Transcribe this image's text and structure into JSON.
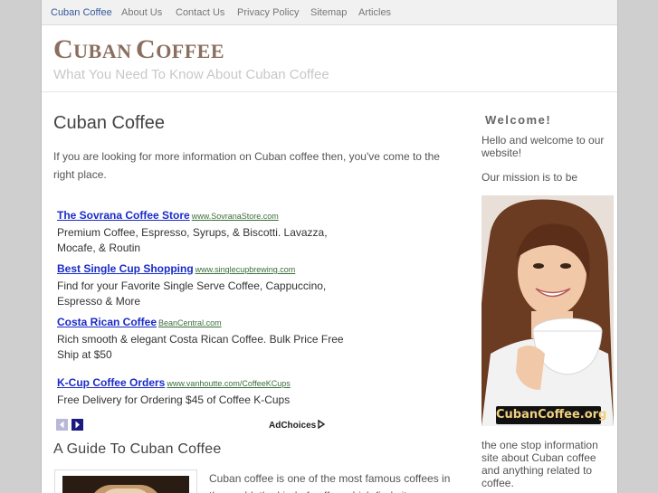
{
  "nav": {
    "items": [
      {
        "label": "Cuban Coffee",
        "active": true
      },
      {
        "label": "About Us"
      },
      {
        "label": "Contact Us"
      },
      {
        "label": "Privacy Policy"
      },
      {
        "label": "Sitemap"
      },
      {
        "label": "Articles"
      }
    ]
  },
  "header": {
    "title_first_cap": "C",
    "title_first_rest": "UBAN",
    "title_second_cap": "C",
    "title_second_rest": "OFFEE",
    "tagline": "What You Need To Know About Cuban Coffee"
  },
  "main": {
    "post_title": "Cuban Coffee",
    "intro": "If you are looking for more information on Cuban coffee then, you've come to the right place.",
    "ads": [
      {
        "title": "The Sovrana Coffee Store",
        "url": "www.SovranaStore.com",
        "desc": "Premium Coffee, Espresso, Syrups, & Biscotti. Lavazza, Mocafe, & Routin"
      },
      {
        "title": "Best Single Cup Shopping",
        "url": "www.singlecupbrewing.com",
        "desc": "Find for your Favorite Single Serve Coffee, Cappuccino, Espresso & More"
      },
      {
        "title": "Costa Rican Coffee",
        "url": "BeanCentral.com",
        "desc": "Rich smooth & elegant Costa Rican Coffee. Bulk Price Free Ship at $50"
      },
      {
        "title": "K-Cup Coffee Orders",
        "url": "www.vanhoutte.com/CoffeeKCups",
        "desc": "Free Delivery for Ordering $45 of Coffee K-Cups"
      }
    ],
    "adchoices": "AdChoices",
    "guide_heading": "A Guide To Cuban Coffee",
    "article_text": "Cuban coffee is one of the most famous coffees in the world, the kind of coffee which finds its"
  },
  "sidebar": {
    "title": "Welcome!",
    "hello": "Hello and welcome to our website!",
    "mission": "Our mission is to be",
    "logo_text": "CubanCoffee.org",
    "bottom": "the one stop information site about Cuban coffee and anything related to coffee."
  }
}
